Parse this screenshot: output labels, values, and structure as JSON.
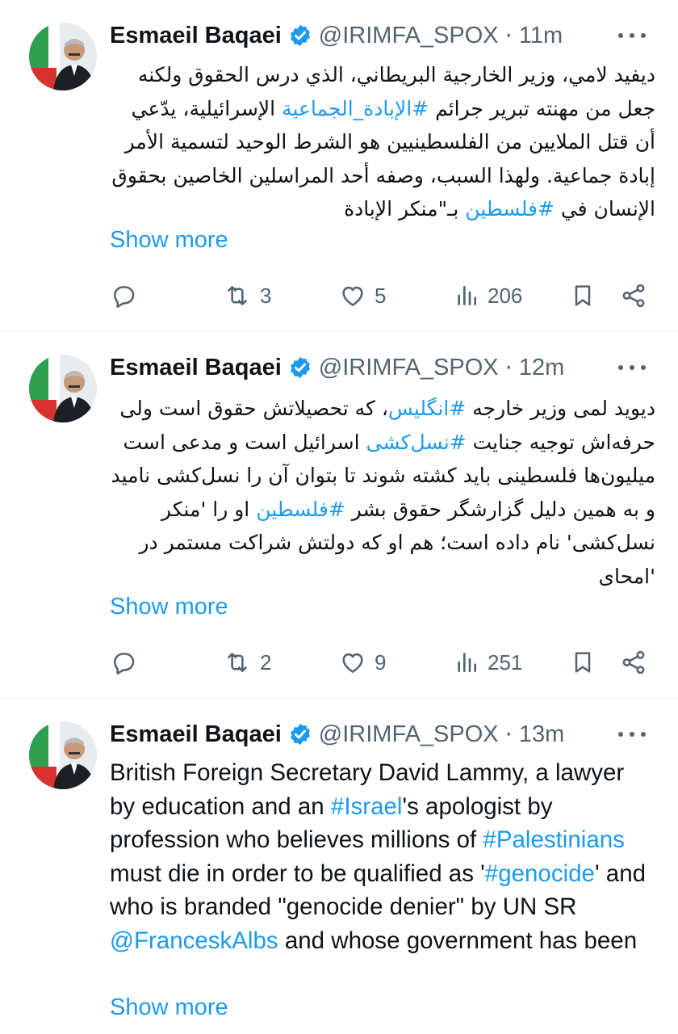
{
  "author": {
    "name": "Esmaeil Baqaei",
    "handle": "@IRIMFA_SPOX",
    "separator": "·"
  },
  "colors": {
    "link": "#1d9bf0",
    "verified": "#1d9bf0",
    "secondary_text": "#536471"
  },
  "show_more_label": "Show more",
  "tweets": [
    {
      "time": "11m",
      "text_segments": [
        {
          "text": "ديفيد لامي، وزير الخارجية البريطاني، الذي درس الحقوق ولكنه جعل من مهنته تبرير جرائم "
        },
        {
          "text": "#الإبادة_الجماعية",
          "link": true
        },
        {
          "text": " الإسرائيلية، يدّعي أن قتل الملايين من الفلسطينيين هو الشرط الوحيد لتسمية الأمر إبادة جماعية. ولهذا السبب، وصفه أحد المراسلين الخاصين بحقوق الإنسان في "
        },
        {
          "text": "#فلسطين",
          "link": true
        },
        {
          "text": " بـ\"منكر الإبادة"
        }
      ],
      "stats": {
        "replies": "",
        "reposts": "3",
        "likes": "5",
        "views": "206"
      }
    },
    {
      "time": "12m",
      "text_segments": [
        {
          "text": "دیوید لمی وزیر خارجه "
        },
        {
          "text": "#انگلیس",
          "link": true
        },
        {
          "text": "، که تحصیلاتش حقوق است ولی حرفه‌اش توجیه جنایت "
        },
        {
          "text": "#نسل‌کشی",
          "link": true
        },
        {
          "text": " اسرائیل است و مدعی است میلیون‌ها فلسطینی باید کشته شوند تا بتوان آن را نسل‌کشی نامید و به همین دلیل گزارشگر حقوق بشر "
        },
        {
          "text": "#فلسطین",
          "link": true
        },
        {
          "text": " او را 'منکر نسل‌کشی' نام داده است؛ هم او که دولتش شراکت مستمر در 'امحای"
        }
      ],
      "stats": {
        "replies": "",
        "reposts": "2",
        "likes": "9",
        "views": "251"
      }
    },
    {
      "time": "13m",
      "text_segments": [
        {
          "text": "British Foreign Secretary David Lammy, a lawyer by education and an "
        },
        {
          "text": "#Israel",
          "link": true
        },
        {
          "text": "'s apologist by profession who believes millions of "
        },
        {
          "text": "#Palestinians",
          "link": true
        },
        {
          "text": " must die in order to be qualified as '"
        },
        {
          "text": "#genocide",
          "link": true
        },
        {
          "text": "' and who is branded \"genocide denier\" by UN SR "
        },
        {
          "text": "@FranceskAlbs",
          "link": true
        },
        {
          "text": " and whose government has been"
        }
      ]
    }
  ]
}
